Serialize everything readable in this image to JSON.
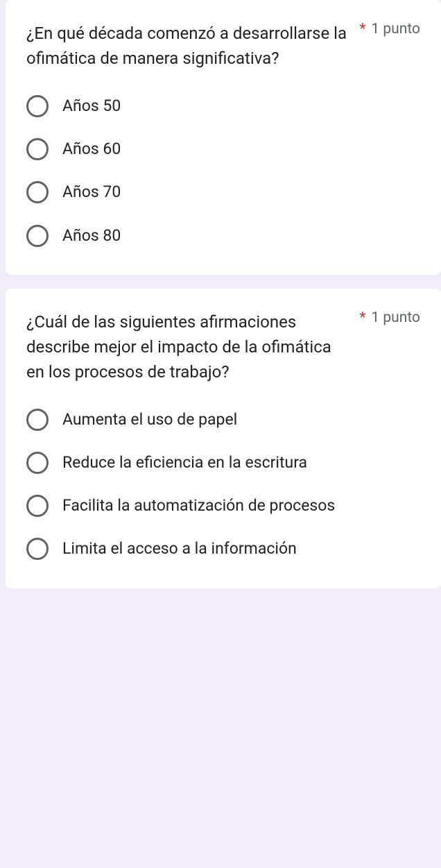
{
  "questions": [
    {
      "text": "¿En qué década comenzó a desarrollarse la ofimática de manera significativa?",
      "required": "*",
      "points": "1 punto",
      "options": [
        "Años 50",
        "Años 60",
        "Años 70",
        "Años 80"
      ]
    },
    {
      "text": "¿Cuál de las siguientes afirmaciones describe mejor el impacto de la ofimática en los procesos de trabajo?",
      "required": "*",
      "points": "1 punto",
      "options": [
        "Aumenta el uso de papel",
        "Reduce la eficiencia en la escritura",
        "Facilita la automatización de procesos",
        "Limita el acceso a la información"
      ]
    }
  ]
}
